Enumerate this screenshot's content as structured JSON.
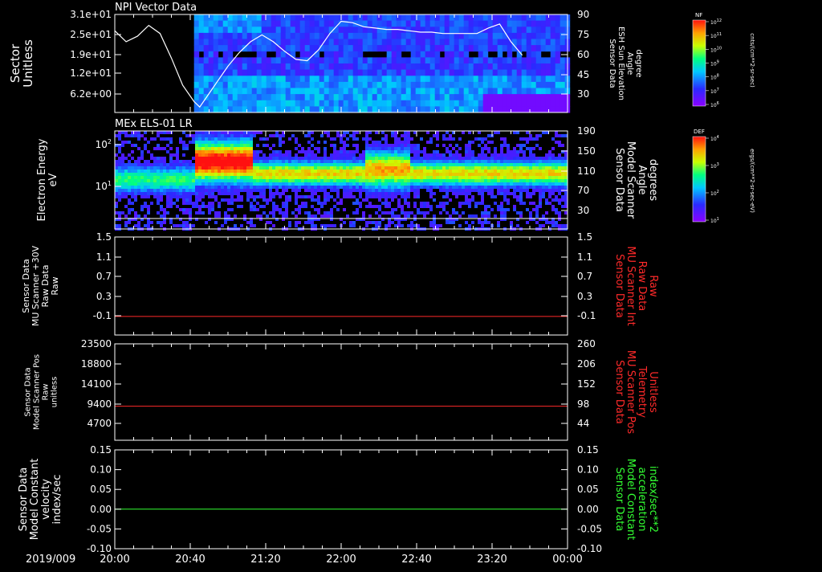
{
  "chart_data": [
    {
      "type": "heatmap",
      "title": "NPI Vector Data",
      "ylabel": "Sector\nUnitless",
      "ytick_labels": [
        "3.1e+01",
        "2.5e+01",
        "1.9e+01",
        "1.2e+01",
        "6.2e+00"
      ],
      "ytick_values": [
        31,
        25,
        19,
        12,
        6.2
      ],
      "ylim": [
        0,
        31
      ],
      "right_axis": {
        "label": "Sensor Data\nESH Sun Elevation\nAngle\ndegree",
        "ytick_labels": [
          "90",
          "75",
          "60",
          "45",
          "30"
        ],
        "ytick_values": [
          90,
          75,
          60,
          45,
          30
        ],
        "ylim": [
          18,
          90
        ]
      },
      "line_series": {
        "x_hours": [
          20.0,
          20.1,
          20.2,
          20.3,
          20.4,
          20.5,
          20.6,
          20.7,
          20.75,
          20.8,
          20.9,
          21.0,
          21.1,
          21.2,
          21.3,
          21.4,
          21.5,
          21.6,
          21.7,
          21.8,
          21.9,
          22.0,
          22.1,
          22.2,
          22.3,
          22.4,
          22.5,
          22.6,
          22.7,
          22.8,
          22.9,
          23.0,
          23.1,
          23.2,
          23.3,
          23.4,
          23.5,
          23.6
        ],
        "values": [
          78,
          70,
          74,
          82,
          76,
          58,
          38,
          26,
          22,
          28,
          40,
          52,
          62,
          70,
          75,
          70,
          63,
          57,
          56,
          64,
          76,
          85,
          84,
          81,
          80,
          79,
          79,
          78,
          77,
          77,
          76,
          76,
          76,
          76,
          80,
          83,
          70,
          60
        ]
      },
      "colorbar": {
        "label": "NF",
        "units": "cnts/(cm**2-sr-sec)",
        "tick_labels": [
          "10^12",
          "10^11",
          "10^10",
          "10^9",
          "10^8",
          "10^7",
          "10^6"
        ]
      }
    },
    {
      "type": "heatmap",
      "title": "MEx ELS-01 LR",
      "ylabel": "Electron Energy\neV",
      "ytick_labels": [
        "10^2",
        "10^1"
      ],
      "ytick_values": [
        100,
        10
      ],
      "yscale": "log",
      "right_axis": {
        "label": "Sensor Data\nModel Scanner\nAngle\ndegrees",
        "ytick_labels": [
          "190",
          "150",
          "110",
          "70",
          "30"
        ],
        "ytick_values": [
          190,
          150,
          110,
          70,
          30
        ],
        "ylim": [
          0,
          190
        ]
      },
      "colorbar": {
        "label": "DEF",
        "units": "ergs/(cm**2-sr-sec-eV)",
        "tick_labels": [
          "10^4",
          "10^3",
          "10^2",
          "10^1"
        ]
      }
    },
    {
      "type": "line",
      "ylabel": "Sensor Data\nMU Scanner +30V\nRaw Data\nRaw",
      "ytick_labels": [
        "1.5",
        "1.1",
        "0.7",
        "0.3",
        "-0.1"
      ],
      "ylim": [
        -0.35,
        1.5
      ],
      "right_axis": {
        "label": "Sensor Data\nMU Scanner Int\nRaw Data\nRaw",
        "ytick_labels": [
          "1.5",
          "1.1",
          "0.7",
          "0.3",
          "-0.1"
        ],
        "color": "#ff2a2a"
      },
      "series": [
        {
          "color": "#ff2a2a",
          "constant": 0.0
        }
      ]
    },
    {
      "type": "line",
      "ylabel": "Sensor Data\nModel Scanner Pos\nRaw\nunitless",
      "ytick_labels": [
        "23500",
        "18800",
        "14100",
        "9400",
        "4700"
      ],
      "ylim": [
        0,
        23500
      ],
      "right_axis": {
        "label": "Sensor Data\nMU Scanner Pos\nTelemetry\nUnitless",
        "ytick_labels": [
          "260",
          "206",
          "152",
          "98",
          "44"
        ],
        "color": "#ff2a2a"
      },
      "series": [
        {
          "color": "#ff2a2a",
          "constant": 8300
        }
      ]
    },
    {
      "type": "line",
      "ylabel": "Sensor Data\nModel Constant\nvelocity\nindex/sec",
      "ytick_labels": [
        "0.15",
        "0.10",
        "0.05",
        "0.00",
        "-0.05",
        "-0.10"
      ],
      "ylim": [
        -0.1,
        0.15
      ],
      "right_axis": {
        "label": "Sensor Data\nModel Constant\nacceleration\nindex/sec**2",
        "ytick_labels": [
          "0.15",
          "0.10",
          "0.05",
          "0.00",
          "-0.05",
          "-0.10"
        ],
        "color": "#33ff33"
      },
      "series": [
        {
          "color": "#33ff33",
          "constant": 0.0
        }
      ]
    }
  ],
  "xaxis": {
    "date_label": "2019/009",
    "tick_labels": [
      "20:00",
      "20:40",
      "21:20",
      "22:00",
      "22:40",
      "23:20",
      "00:00"
    ],
    "range_hours": [
      20,
      24
    ]
  }
}
